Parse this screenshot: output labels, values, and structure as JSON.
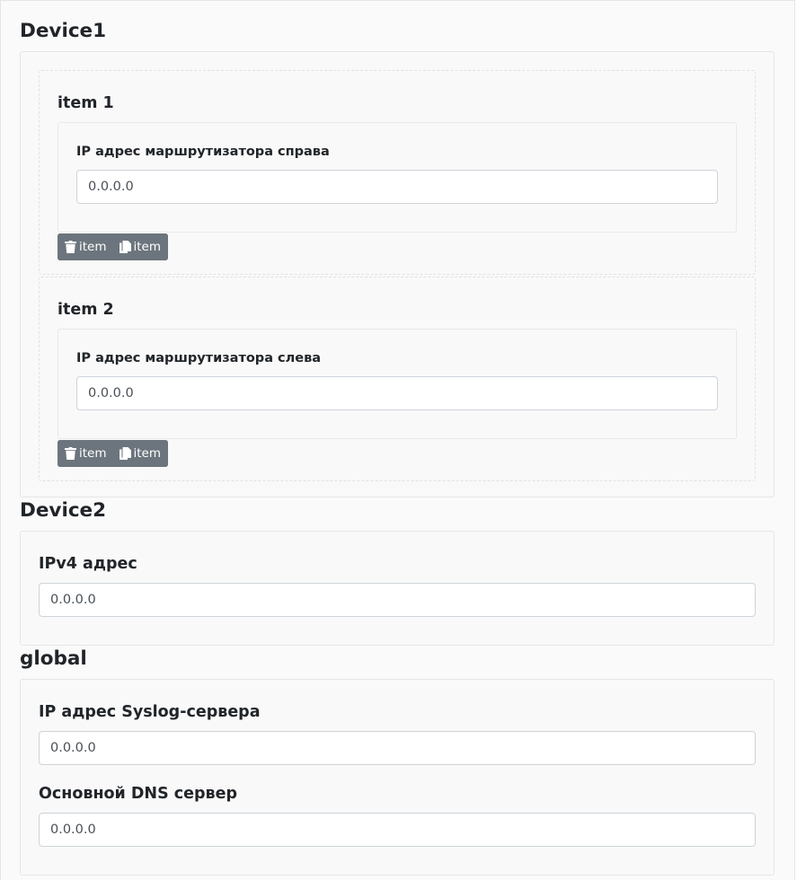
{
  "sections": {
    "device1": {
      "title": "Device1",
      "items": [
        {
          "title": "item 1",
          "field_label": "IP адрес маршрутизатора справа",
          "field_value": "0.0.0.0",
          "delete_label": "item",
          "copy_label": "item"
        },
        {
          "title": "item 2",
          "field_label": "IP адрес маршрутизатора слева",
          "field_value": "0.0.0.0",
          "delete_label": "item",
          "copy_label": "item"
        }
      ]
    },
    "device2": {
      "title": "Device2",
      "ipv4_label": "IPv4 адрес",
      "ipv4_value": "0.0.0.0"
    },
    "global": {
      "title": "global",
      "syslog_label": "IP адрес Syslog-сервера",
      "syslog_value": "0.0.0.0",
      "dns_label": "Основной DNS сервер",
      "dns_value": "0.0.0.0"
    }
  },
  "icons": {
    "delete": "trash-icon",
    "copy": "copy-icon"
  },
  "colors": {
    "button_bg": "#6c757d",
    "card_border": "#e6e6e6",
    "input_border": "#ced4da"
  }
}
